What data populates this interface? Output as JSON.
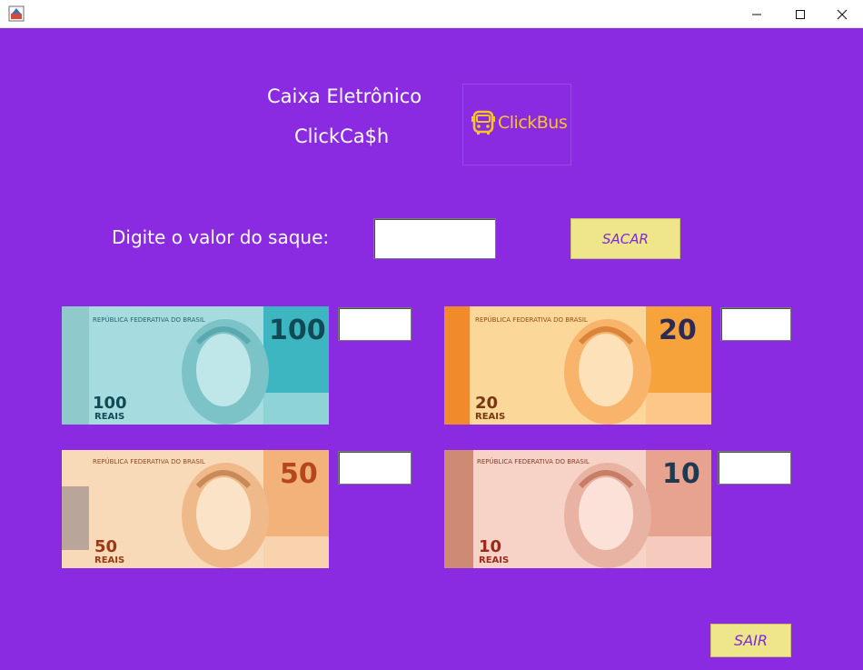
{
  "window": {
    "minimize_glyph": "—",
    "maximize_glyph": "☐",
    "close_glyph": "✕"
  },
  "header": {
    "title_line1": "Caixa Eletrônico",
    "title_line2": "ClickCa$h",
    "logo_text": "ClickBus"
  },
  "withdraw": {
    "prompt": "Digite o valor do saque:",
    "amount_value": "",
    "submit_label": "SACAR"
  },
  "notes": [
    {
      "denomination": "100",
      "issuer": "REPÚBLICA FEDERATIVA DO BRASIL",
      "currency": "REAIS",
      "count_value": "",
      "color": "#7fd0d6"
    },
    {
      "denomination": "20",
      "issuer": "REPÚBLICA FEDERATIVA DO BRASIL",
      "currency": "REAIS",
      "count_value": "",
      "color": "#f6b158"
    },
    {
      "denomination": "50",
      "issuer": "REPÚBLICA FEDERATIVA DO BRASIL",
      "currency": "REAIS",
      "count_value": "",
      "color": "#f3c294"
    },
    {
      "denomination": "10",
      "issuer": "REPÚBLICA FEDERATIVA DO BRASIL",
      "currency": "REAIS",
      "count_value": "",
      "color": "#e9a99a"
    }
  ],
  "footer": {
    "exit_label": "SAIR"
  },
  "colors": {
    "background": "#8a2be2",
    "button_fill": "#efe58a",
    "button_text": "#7a2dd6",
    "logo_accent": "#f6c426"
  }
}
